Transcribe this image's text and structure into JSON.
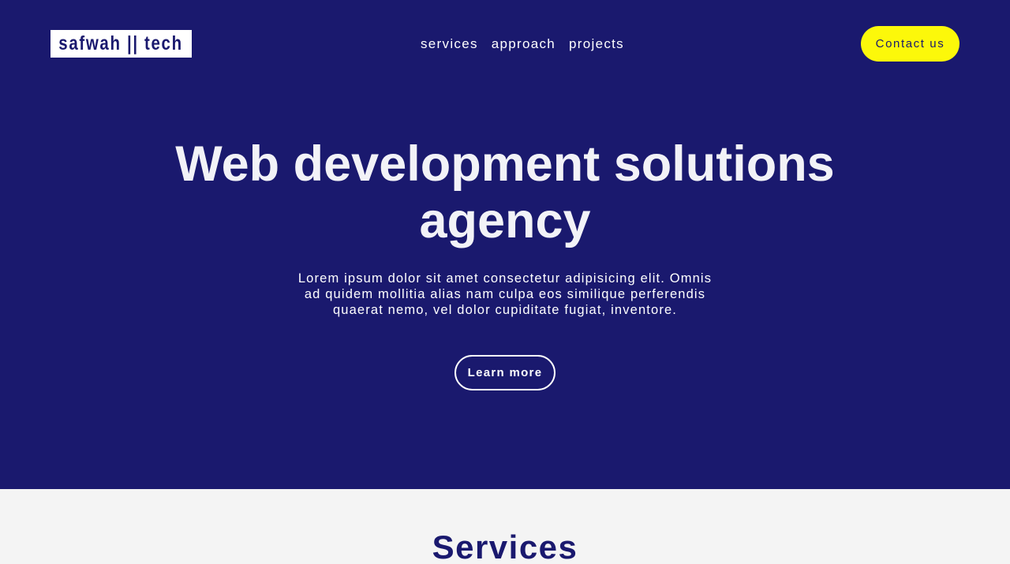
{
  "header": {
    "logo_text": "safwah || tech",
    "nav": [
      {
        "label": "services"
      },
      {
        "label": "approach"
      },
      {
        "label": "projects"
      }
    ],
    "contact_label": "Contact us"
  },
  "hero": {
    "title": "Web development solutions agency",
    "text": "Lorem ipsum dolor sit amet consectetur adipisicing elit. Omnis ad quidem mollitia alias nam culpa eos similique perferendis quaerat nemo, vel dolor cupiditate fugiat, inventore.",
    "cta_label": "Learn more"
  },
  "services": {
    "title": "Services"
  },
  "colors": {
    "primary": "#1a196e",
    "accent": "#fcf80a",
    "light_bg": "#f4f4f4"
  }
}
